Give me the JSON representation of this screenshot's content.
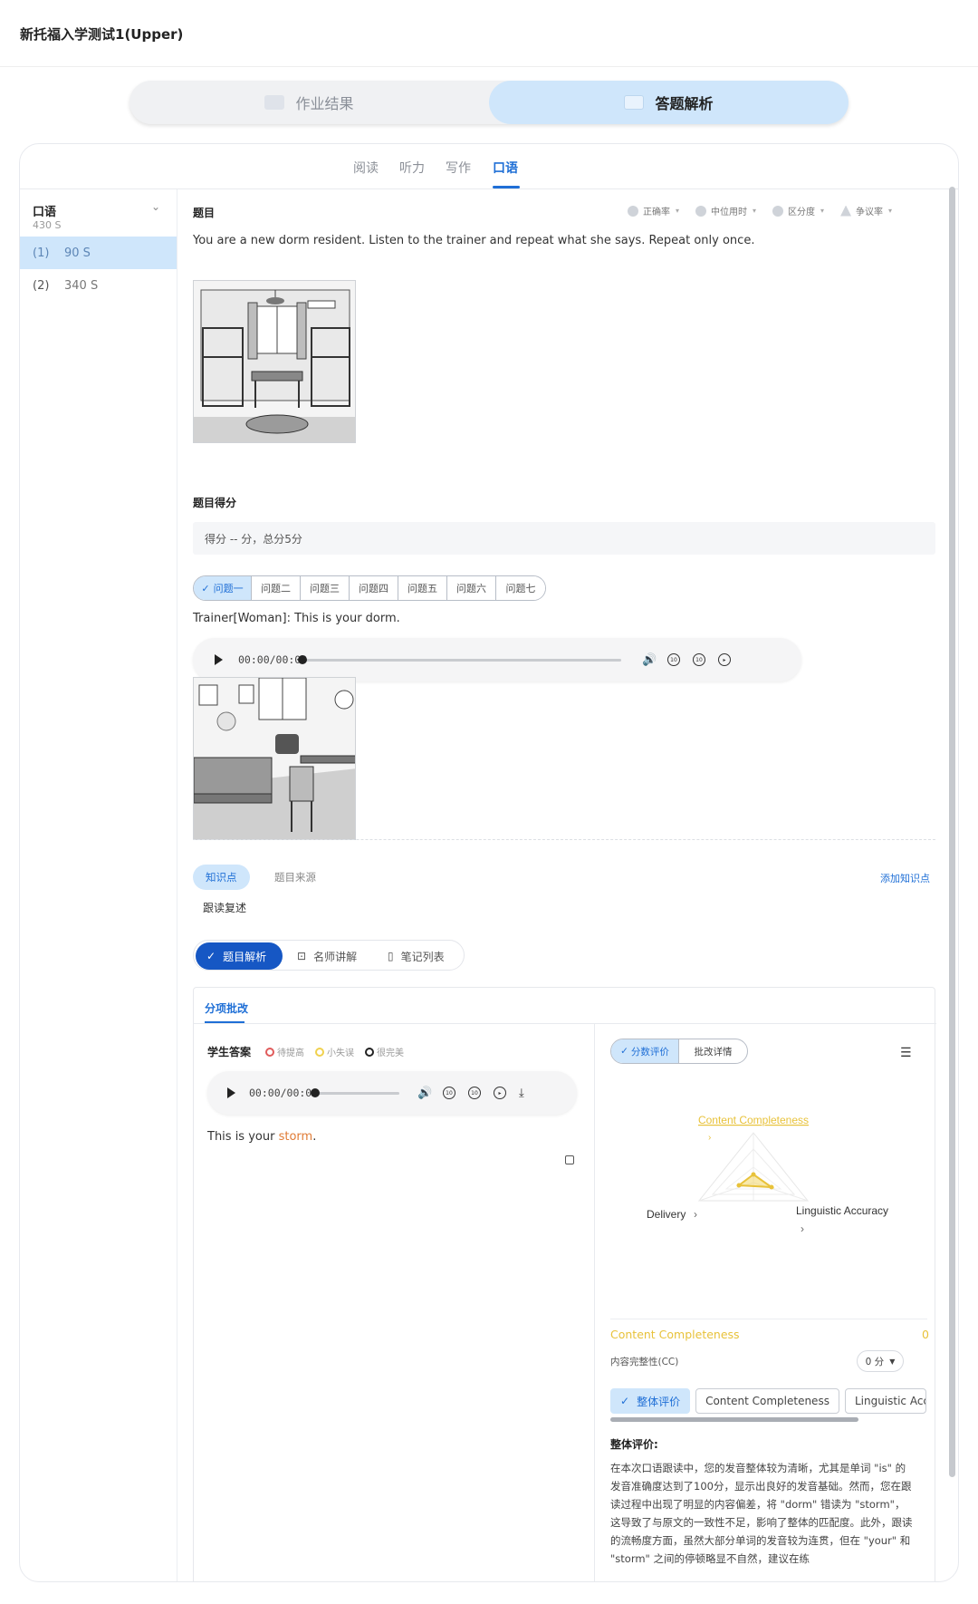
{
  "app": {
    "title": "新托福入学测试1(Upper)"
  },
  "main_tabs": [
    {
      "label": "作业结果",
      "active": false
    },
    {
      "label": "答题解析",
      "active": true
    }
  ],
  "skill_tabs": [
    {
      "label": "阅读",
      "active": false
    },
    {
      "label": "听力",
      "active": false
    },
    {
      "label": "写作",
      "active": false
    },
    {
      "label": "口语",
      "active": true
    }
  ],
  "sidebar": {
    "section": "口语",
    "total": "430 S",
    "items": [
      {
        "num": "(1)",
        "sec": "90 S",
        "active": true
      },
      {
        "num": "(2)",
        "sec": "340 S",
        "active": false
      }
    ]
  },
  "question": {
    "title": "题目",
    "stats": [
      "正确率",
      "中位用时",
      "区分度",
      "争议率"
    ],
    "prompt": "You are a new dorm resident. Listen to the trainer and repeat what she says. Repeat only once.",
    "score_title": "题目得分",
    "score_text": "得分 -- 分，总分5分",
    "sub_tabs": [
      "问题一",
      "问题二",
      "问题三",
      "问题四",
      "问题五",
      "问题六",
      "问题七"
    ],
    "trainer_text": "Trainer[Woman]: This is your dorm.",
    "audio_time": "00:00/00:00"
  },
  "knowledge": {
    "tabs": [
      "知识点",
      "题目来源"
    ],
    "add_label": "添加知识点",
    "value": "跟读复述"
  },
  "analysis_tabs": [
    "题目解析",
    "名师讲解",
    "笔记列表"
  ],
  "review": {
    "tab": "分项批改",
    "student_answer_title": "学生答案",
    "legend": [
      "待提高",
      "小失误",
      "很完美"
    ],
    "audio_time": "00:00/00:08",
    "answer_prefix": "This is your ",
    "answer_error": "storm",
    "answer_suffix": ".",
    "eval_tabs": [
      "分数评价",
      "批改详情"
    ],
    "radar_labels": {
      "top": "Content Completeness",
      "left": "Delivery",
      "right": "Linguistic Accuracy"
    },
    "cc_title": "Content Completeness",
    "cc_score": "0",
    "cc_sub": "内容完整性(CC)",
    "cc_select": "0 分",
    "result_tabs": [
      "整体评价",
      "Content Completeness",
      "Linguistic Accu"
    ],
    "overall_title": "整体评价:",
    "overall_text": "在本次口语跟读中，您的发音整体较为清晰，尤其是单词 \"is\" 的发音准确度达到了100分，显示出良好的发音基础。然而，您在跟读过程中出现了明显的内容偏差，将 \"dorm\" 错读为 \"storm\"，这导致了与原文的一致性不足，影响了整体的匹配度。此外，跟读的流畅度方面，虽然大部分单词的发音较为连贯，但在 \"your\" 和 \"storm\" 之间的停顿略显不自然，建议在练"
  },
  "colors": {
    "accent": "#1f6fd6",
    "active_tab_bg": "#cfe6fb",
    "cc_yellow": "#e8c23a",
    "error_orange": "#e07b35"
  }
}
